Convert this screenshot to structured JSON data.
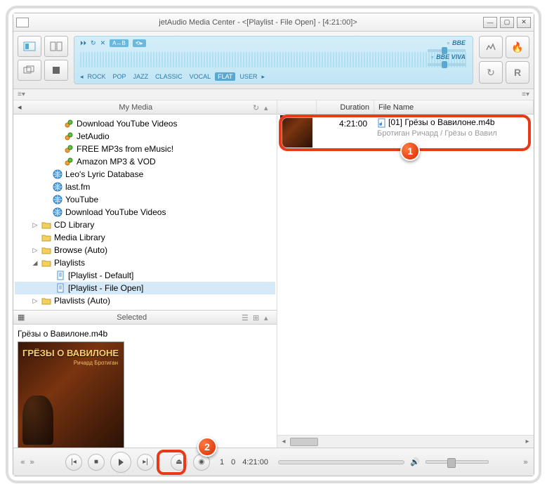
{
  "window": {
    "title": "jetAudio Media Center - <[Playlist - File Open] - [4:21:00]>"
  },
  "display": {
    "ab": "A↔B",
    "eq_presets": [
      "ROCK",
      "POP",
      "JAZZ",
      "CLASSIC",
      "VOCAL",
      "FLAT",
      "USER"
    ],
    "eq_active": "FLAT",
    "bbe": "BBE",
    "bbe_viva": "BBE VIVA"
  },
  "sidebar": {
    "header": "My Media",
    "items": [
      {
        "label": "Download YouTube Videos",
        "indent": 56,
        "icon": "link"
      },
      {
        "label": "JetAudio",
        "indent": 56,
        "icon": "link"
      },
      {
        "label": "FREE MP3s from eMusic!",
        "indent": 56,
        "icon": "link"
      },
      {
        "label": "Amazon MP3 & VOD",
        "indent": 56,
        "icon": "link"
      },
      {
        "label": "Leo's Lyric Database",
        "indent": 40,
        "icon": "globe"
      },
      {
        "label": "last.fm",
        "indent": 40,
        "icon": "globe"
      },
      {
        "label": "YouTube",
        "indent": 40,
        "icon": "globe"
      },
      {
        "label": "Download YouTube Videos",
        "indent": 40,
        "icon": "globe"
      },
      {
        "label": "CD Library",
        "indent": 24,
        "icon": "folder",
        "exp": "▷"
      },
      {
        "label": "Media Library",
        "indent": 24,
        "icon": "folder"
      },
      {
        "label": "Browse (Auto)",
        "indent": 24,
        "icon": "folder",
        "exp": "▷"
      },
      {
        "label": "Playlists",
        "indent": 24,
        "icon": "folder",
        "exp": "◢"
      },
      {
        "label": "[Playlist - Default]",
        "indent": 44,
        "icon": "doc"
      },
      {
        "label": "[Playlist - File Open]",
        "indent": 44,
        "icon": "doc",
        "sel": true
      },
      {
        "label": "Plavlists (Auto)",
        "indent": 24,
        "icon": "folder",
        "exp": "▷"
      }
    ]
  },
  "selected": {
    "header": "Selected",
    "filename": "Грёзы о Вавилоне.m4b",
    "cover_title": "ГРЁЗЫ О ВАВИЛОНЕ",
    "cover_author": "Ричард\nБротиган"
  },
  "playlist": {
    "cols": {
      "duration": "Duration",
      "filename": "File Name"
    },
    "tracks": [
      {
        "duration": "4:21:00",
        "name": "[01] Грёзы о Вавилоне.m4b",
        "sub": "Бротиган Ричард / Грёзы о Вавил"
      }
    ]
  },
  "bottom": {
    "track_no": "1",
    "pos": "0",
    "total": "4:21:00"
  },
  "badges": {
    "b1": "1",
    "b2": "2"
  }
}
